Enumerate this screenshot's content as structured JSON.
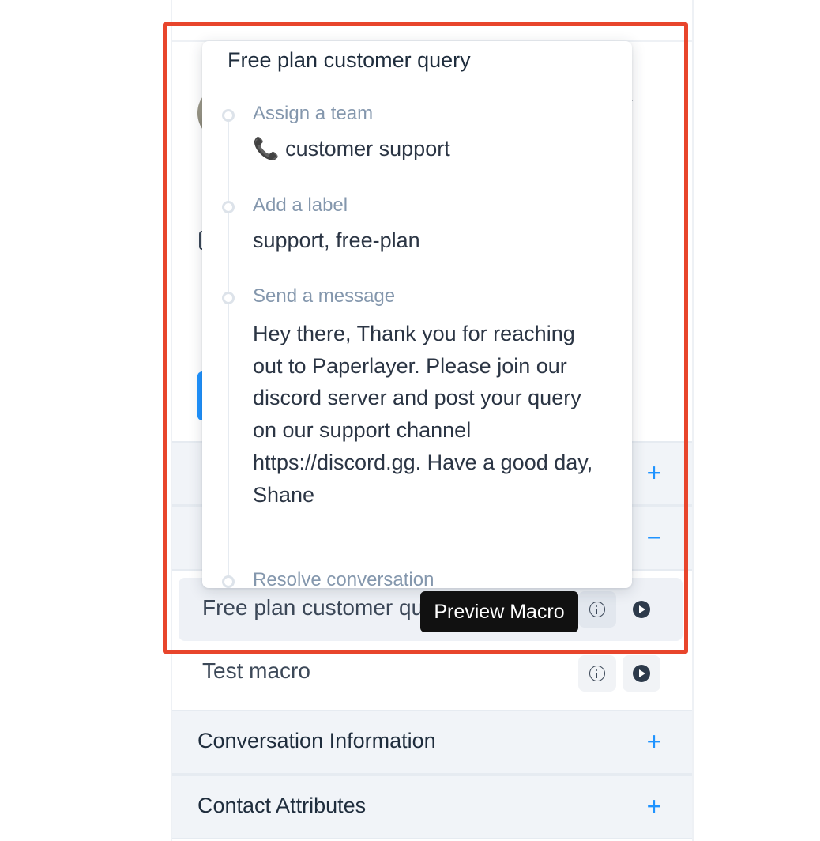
{
  "popover": {
    "title": "Free plan customer query",
    "steps": [
      {
        "label": "Assign a team",
        "value": "📞 customer support"
      },
      {
        "label": "Add a label",
        "value": "support, free-plan"
      },
      {
        "label": "Send a message",
        "value": "Hey there, Thank you for reaching out to Paperlayer. Please join our discord server and post your query on our support channel https://discord.gg. Have a good day, Shane"
      },
      {
        "label": "Resolve conversation",
        "value": ""
      }
    ]
  },
  "macros": [
    {
      "name": "Free plan customer query",
      "info_icon": "info-icon",
      "run_icon": "play-icon"
    },
    {
      "name": "Test macro",
      "info_icon": "info-icon",
      "run_icon": "play-icon"
    }
  ],
  "tooltip": {
    "text": "Preview Macro"
  },
  "sections": [
    {
      "title": "Conversation Information",
      "toggle": "+"
    },
    {
      "title": "Contact Attributes",
      "toggle": "+"
    }
  ],
  "hidden_section_toggles": [
    "+",
    "−"
  ],
  "colors": {
    "accent": "#1f93ff",
    "highlight_border": "#e8452c",
    "tooltip_bg": "#111111",
    "section_bg": "#f1f4f8"
  }
}
